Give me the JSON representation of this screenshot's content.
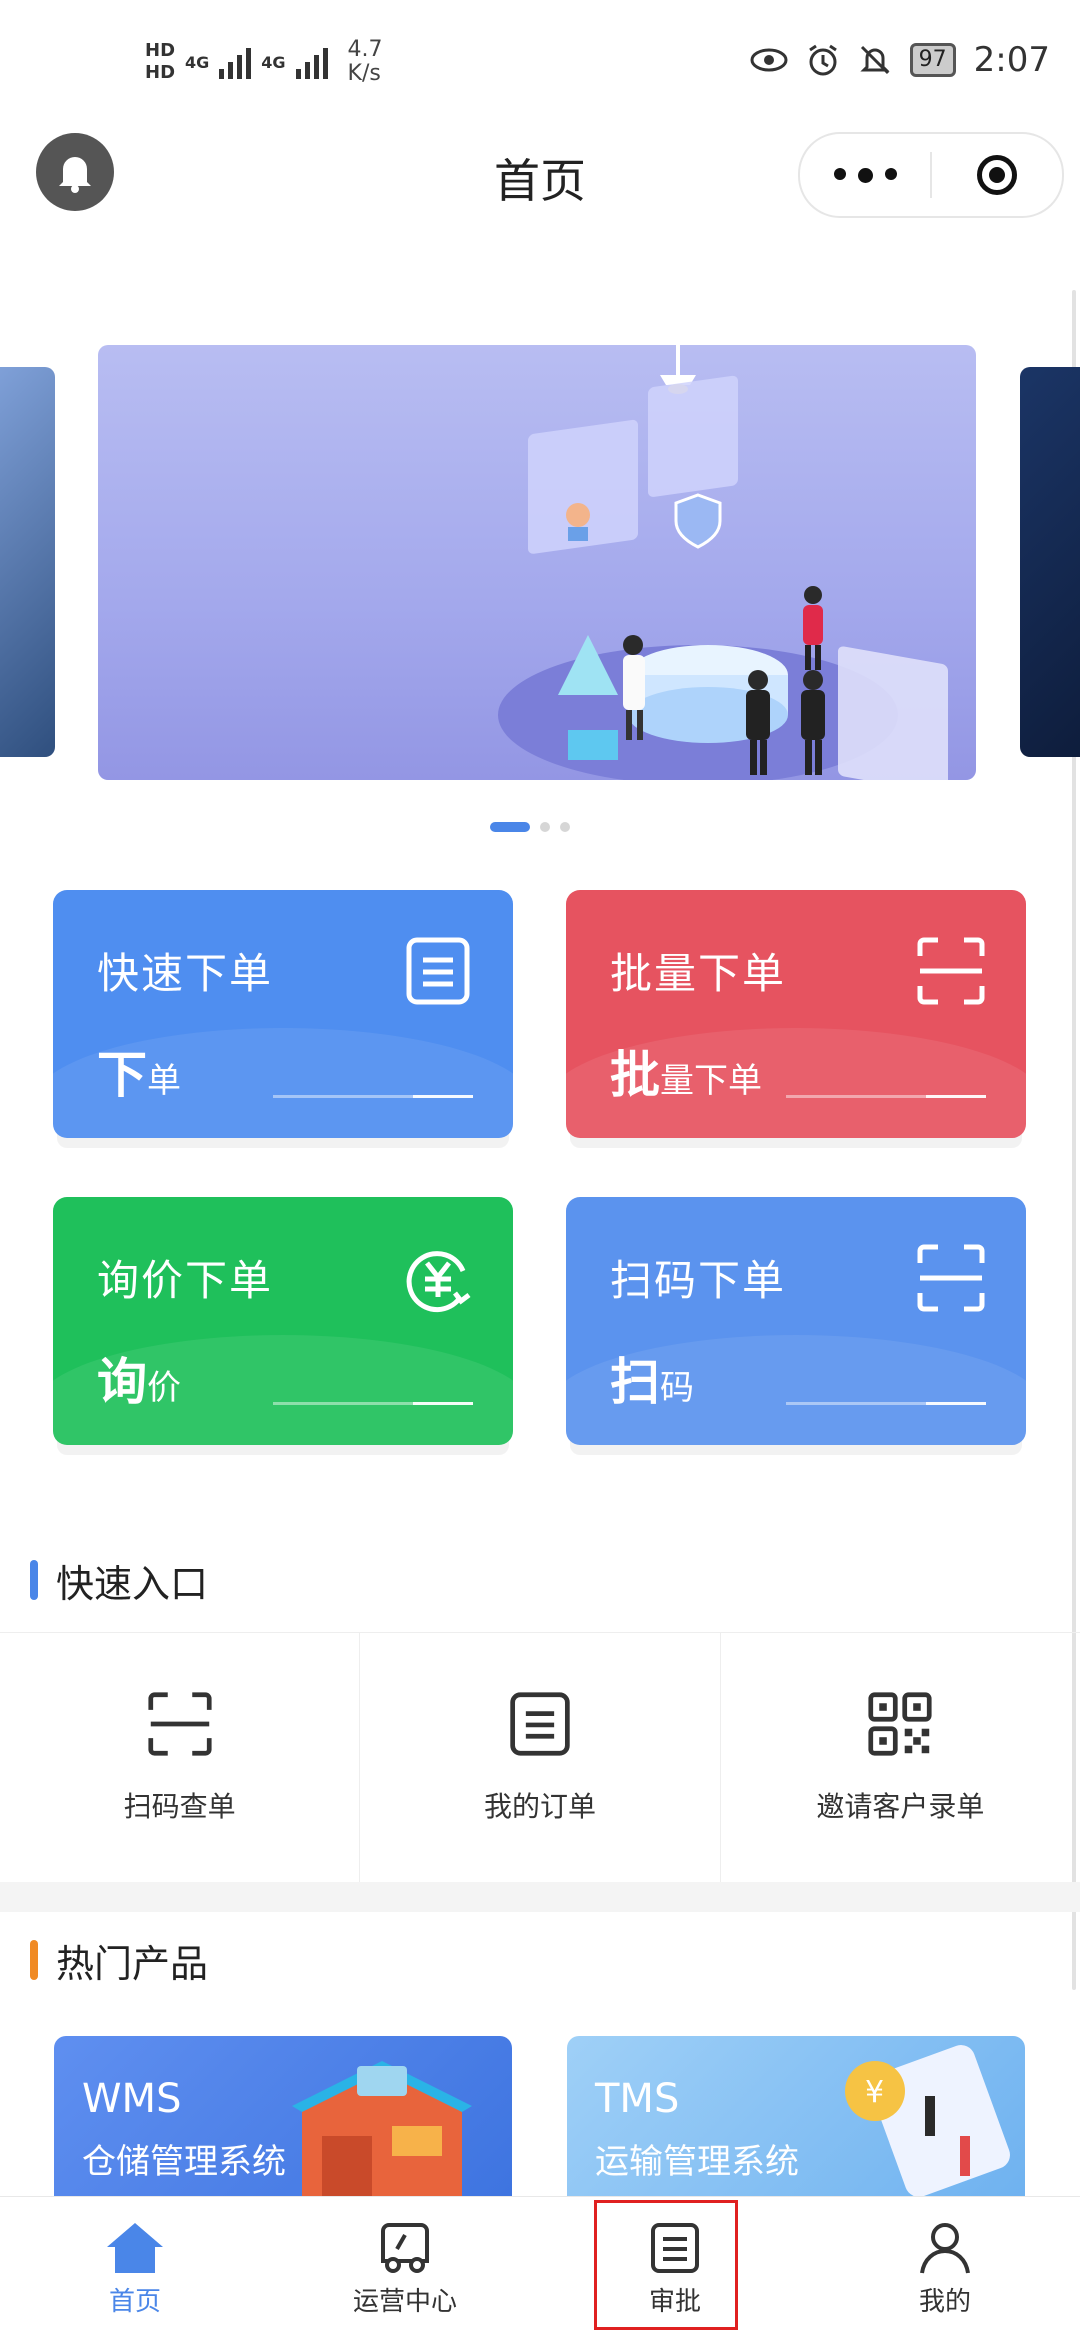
{
  "status_bar": {
    "hd1": "HD",
    "hd2": "HD",
    "net1": "4G",
    "net2": "4G",
    "speed_value": "4.7",
    "speed_unit": "K/s",
    "battery": "97",
    "time": "2:07"
  },
  "nav": {
    "title": "首页"
  },
  "banner": {
    "slide_count": 3,
    "active_index": 0
  },
  "actions": [
    {
      "title": "快速下单",
      "sub_big": "下",
      "sub_small": "单",
      "color": "#4f8ef0",
      "icon": "document-icon"
    },
    {
      "title": "批量下单",
      "sub_big": "批",
      "sub_small": "量下单",
      "color": "#e65360",
      "icon": "scan-icon"
    },
    {
      "title": "询价下单",
      "sub_big": "询",
      "sub_small": "价",
      "color": "#1fc05b",
      "icon": "yuan-refresh-icon"
    },
    {
      "title": "扫码下单",
      "sub_big": "扫",
      "sub_small": "码",
      "color": "#5b93ee",
      "icon": "scan-icon"
    }
  ],
  "quick_entry": {
    "title": "快速入口",
    "accent": "#4a86e8",
    "items": [
      {
        "label": "扫码查单",
        "icon": "scan-icon"
      },
      {
        "label": "我的订单",
        "icon": "order-icon"
      },
      {
        "label": "邀请客户录单",
        "icon": "qr-code-icon"
      }
    ]
  },
  "hot_products": {
    "title": "热门产品",
    "accent": "#f08a24",
    "items": [
      {
        "name": "WMS",
        "desc": "仓储管理系统"
      },
      {
        "name": "TMS",
        "desc": "运输管理系统"
      }
    ]
  },
  "tabbar": {
    "items": [
      {
        "label": "首页",
        "icon": "home-icon",
        "active": true
      },
      {
        "label": "运营中心",
        "icon": "truck-icon",
        "active": false
      },
      {
        "label": "审批",
        "icon": "approval-icon",
        "active": false
      },
      {
        "label": "我的",
        "icon": "user-icon",
        "active": false
      }
    ]
  },
  "colors": {
    "primary": "#4a86e8",
    "highlight_box": "#e02020"
  }
}
